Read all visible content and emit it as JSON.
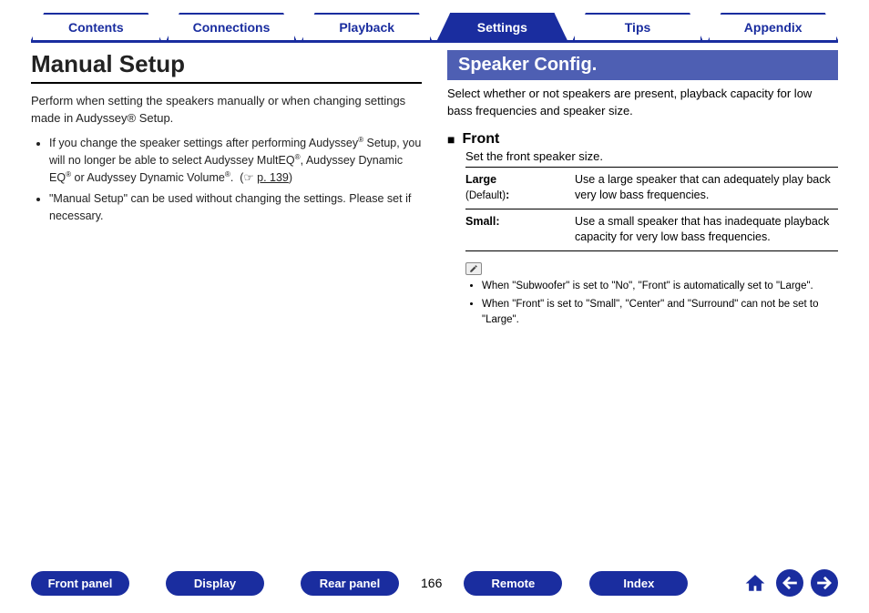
{
  "tabs": [
    {
      "label": "Contents",
      "active": false
    },
    {
      "label": "Connections",
      "active": false
    },
    {
      "label": "Playback",
      "active": false
    },
    {
      "label": "Settings",
      "active": true
    },
    {
      "label": "Tips",
      "active": false
    },
    {
      "label": "Appendix",
      "active": false
    }
  ],
  "left": {
    "title": "Manual Setup",
    "intro": "Perform when setting the speakers manually or when changing settings made in Audyssey® Setup.",
    "notes": [
      "If you change the speaker settings after performing Audyssey® Setup, you will no longer be able to select Audyssey MultEQ®, Audyssey Dynamic EQ® or Audyssey Dynamic Volume®.  (☞ p. 139)",
      "\"Manual Setup\" can be used without changing the settings. Please set if necessary."
    ],
    "ref_text": "p. 139"
  },
  "right": {
    "banner": "Speaker Config.",
    "intro": "Select whether or not speakers are present, playback capacity for low bass frequencies and speaker size.",
    "subhead": "Front",
    "subdesc": "Set the front speaker size.",
    "options": [
      {
        "label_main": "Large",
        "label_sub": "(Default)",
        "suffix": ":",
        "desc": "Use a large speaker that can adequately play back very low bass frequencies."
      },
      {
        "label_main": "Small:",
        "label_sub": "",
        "suffix": "",
        "desc": "Use a small speaker that has inadequate playback capacity for very low bass frequencies."
      }
    ],
    "info": [
      "When \"Subwoofer\" is set to \"No\", \"Front\" is automatically set to \"Large\".",
      "When \"Front\" is set to \"Small\", \"Center\" and \"Surround\" can not be set to \"Large\"."
    ]
  },
  "bottom": {
    "left_buttons": [
      "Front panel",
      "Display",
      "Rear panel"
    ],
    "page": "166",
    "right_buttons": [
      "Remote",
      "Index"
    ]
  }
}
